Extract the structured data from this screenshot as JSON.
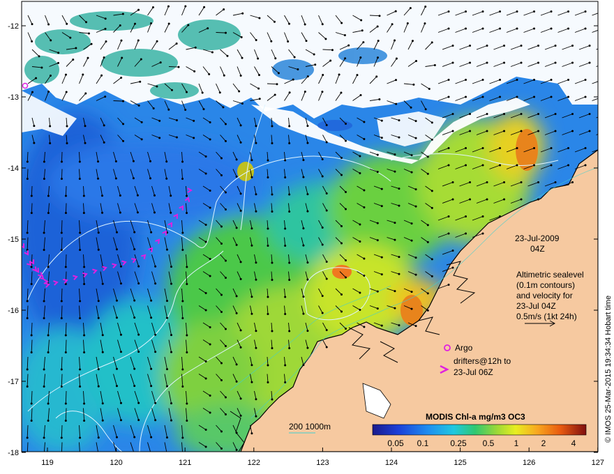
{
  "info": {
    "date": "23-Jul-2009",
    "time": "04Z",
    "desc_lines": [
      "Altimetric sealevel",
      "(0.1m contours)",
      "and velocity for",
      "23-Jul 04Z",
      "0.5m/s (1kt 24h)"
    ]
  },
  "legend": {
    "argo": "Argo",
    "drifters_lines": [
      "drifters@12h to",
      "23-Jul 06Z"
    ],
    "argo_color": "#e020e0",
    "drifter_color": "#e020e0"
  },
  "colorbar": {
    "title": "MODIS Chl-a mg/m3 OC3",
    "ticks": [
      "0.05",
      "0.1",
      "0.25",
      "0.5",
      "1",
      "2",
      "4"
    ]
  },
  "depth_legend": {
    "label": "200  1000m",
    "color": "#40d0d0"
  },
  "credit": "© IMOS 25-Mar-2015 19:34:34 Hobart time",
  "axes": {
    "x_ticks": [
      "119",
      "120",
      "121",
      "122",
      "123",
      "124",
      "125",
      "126",
      "127"
    ],
    "y_ticks": [
      "-12",
      "-13",
      "-14",
      "-15",
      "-16",
      "-17",
      "-18"
    ]
  },
  "colors": {
    "land": "#f6c9a0",
    "coast": "#000000",
    "cloud": "#ffffff",
    "contour": "#dff4ff"
  }
}
